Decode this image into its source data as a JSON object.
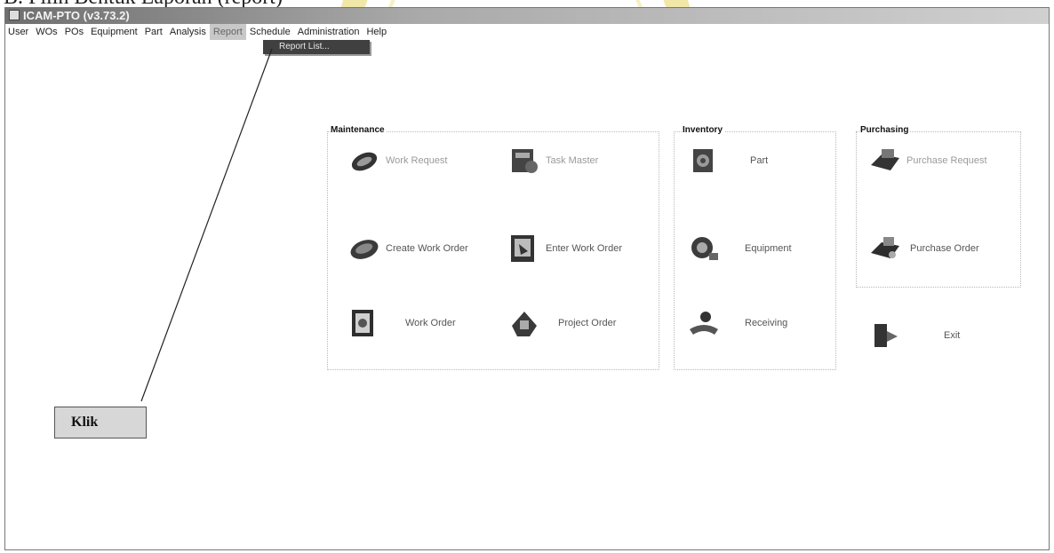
{
  "document": {
    "caption": "B. Pilih Bentuk Laporan (report)"
  },
  "window": {
    "title": "ICAM-PTO (v3.73.2)"
  },
  "menu": {
    "items": [
      "User",
      "WOs",
      "POs",
      "Equipment",
      "Part",
      "Analysis",
      "Report",
      "Schedule",
      "Administration",
      "Help"
    ],
    "active": "Report",
    "dropdown_item": "Report List..."
  },
  "groups": {
    "maintenance": {
      "title": "Maintenance",
      "items": [
        {
          "label": "Work Request",
          "icon": "work-request-icon"
        },
        {
          "label": "Task Master",
          "icon": "task-master-icon"
        },
        {
          "label": "Create Work Order",
          "icon": "create-work-order-icon"
        },
        {
          "label": "Enter Work Order",
          "icon": "enter-work-order-icon"
        },
        {
          "label": "Work Order",
          "icon": "work-order-icon"
        },
        {
          "label": "Project Order",
          "icon": "project-order-icon"
        }
      ]
    },
    "inventory": {
      "title": "Inventory",
      "items": [
        {
          "label": "Part",
          "icon": "part-icon"
        },
        {
          "label": "Equipment",
          "icon": "equipment-icon"
        },
        {
          "label": "Receiving",
          "icon": "receiving-icon"
        }
      ]
    },
    "purchasing": {
      "title": "Purchasing",
      "items": [
        {
          "label": "Purchase Request",
          "icon": "purchase-request-icon"
        },
        {
          "label": "Purchase Order",
          "icon": "purchase-order-icon"
        }
      ]
    }
  },
  "exit": {
    "label": "Exit",
    "icon": "exit-icon"
  },
  "annotation": {
    "label": "Klik"
  }
}
